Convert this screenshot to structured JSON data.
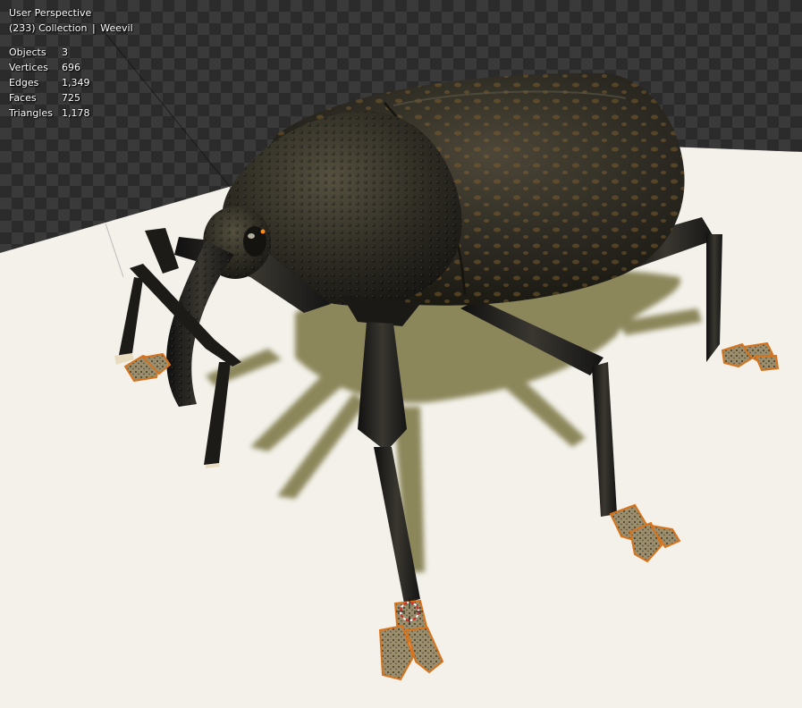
{
  "viewport": {
    "view_name": "User Perspective",
    "frame": "(233)",
    "collection": "Collection",
    "separator": "|",
    "active_object": "Weevil"
  },
  "stats": [
    {
      "label": "Objects",
      "value": "3"
    },
    {
      "label": "Vertices",
      "value": "696"
    },
    {
      "label": "Edges",
      "value": "1,349"
    },
    {
      "label": "Faces",
      "value": "725"
    },
    {
      "label": "Triangles",
      "value": "1,178"
    }
  ],
  "colors": {
    "floor": "#f3f1ea",
    "shadow": "#7a7442",
    "body": "#2b2a22",
    "body_highlight": "#4a4639",
    "foot_pad": "#8a7f62",
    "foot_edge": "#d8731c",
    "cursor": "#d22a2a"
  },
  "icons": [
    "3d-cursor-icon"
  ]
}
